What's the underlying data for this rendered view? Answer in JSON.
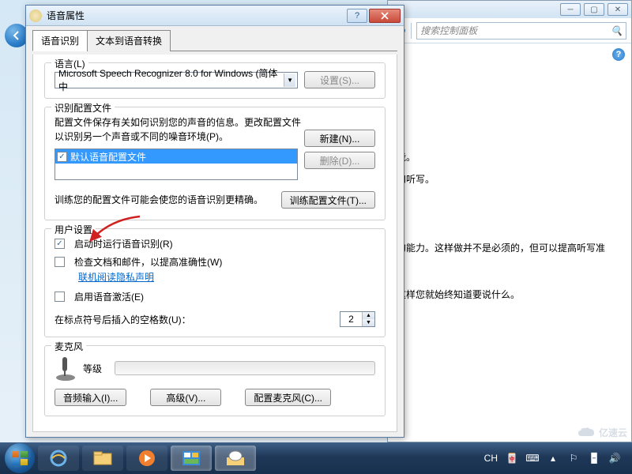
{
  "parent_window": {
    "search_placeholder": "搜索控制面板",
    "bg_lines": [
      "能。",
      "和听写。",
      "的能力。这样做并不是必须的，但可以提高听写准",
      "这样您就始终知道要说什么。"
    ]
  },
  "dialog": {
    "title": "语音属性",
    "tabs": [
      "语音识别",
      "文本到语音转换"
    ],
    "language": {
      "group": "语言(L)",
      "recognizer": "Microsoft Speech Recognizer 8.0 for Windows (简体中",
      "settings_btn": "设置(S)..."
    },
    "profiles": {
      "group": "识别配置文件",
      "desc1": "配置文件保存有关如何识别您的声音的信息。更改配置文件",
      "desc2": "以识别另一个声音或不同的噪音环境(P)。",
      "new_btn": "新建(N)...",
      "delete_btn": "删除(D)...",
      "item": "默认语音配置文件",
      "train_desc": "训练您的配置文件可能会使您的语音识别更精确。",
      "train_btn": "训练配置文件(T)..."
    },
    "user_settings": {
      "group": "用户设置",
      "run_at_startup": "启动时运行语音识别(R)",
      "check_docs": "检查文档和邮件，以提高准确性(W)",
      "privacy_link": "联机阅读隐私声明",
      "enable_activation": "启用语音激活(E)",
      "spaces_label": "在标点符号后插入的空格数(U)：",
      "spaces_value": "2"
    },
    "microphone": {
      "group": "麦克风",
      "level": "等级",
      "audio_input_btn": "音频输入(I)...",
      "advanced_btn": "高级(V)...",
      "configure_btn": "配置麦克风(C)..."
    }
  },
  "taskbar": {
    "ime": "CH",
    "watermark": "亿速云"
  }
}
